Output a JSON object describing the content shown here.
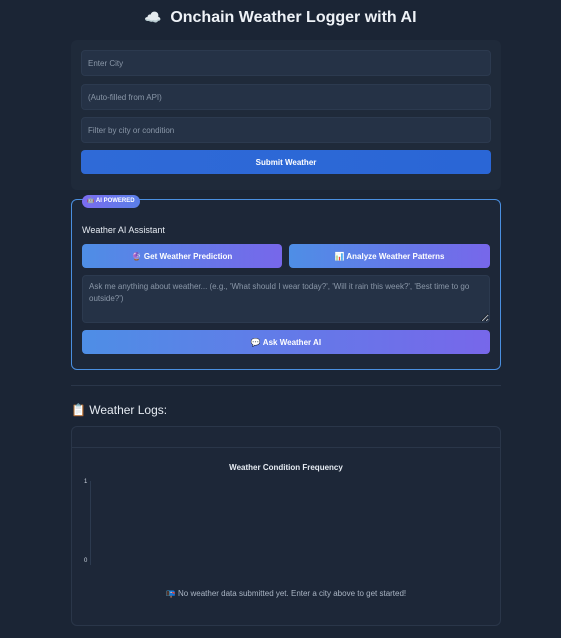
{
  "header": {
    "icon": "☁️",
    "title": "Onchain Weather Logger with AI"
  },
  "form": {
    "city_placeholder": "Enter City",
    "autofill_placeholder": "(Auto-filled from API)",
    "filter_placeholder": "Filter by city or condition",
    "submit_label": "Submit Weather",
    "accent_color": "#2f6ad7"
  },
  "ai": {
    "badge": "🤖 AI POWERED",
    "title": "Weather AI Assistant",
    "predict_label": "🔮 Get Weather Prediction",
    "analyze_label": "📊 Analyze Weather Patterns",
    "prompt_placeholder": "Ask me anything about weather... (e.g., 'What should I wear today?', 'Will it rain this week?', 'Best time to go outside?')",
    "ask_label": "💬 Ask Weather AI",
    "gradient_start": "#4e8ee6",
    "gradient_end": "#7767ea"
  },
  "logs": {
    "heading": "📋 Weather Logs:",
    "empty_message": "📭 No weather data submitted yet. Enter a city above to get started!"
  },
  "chart_data": {
    "type": "bar",
    "title": "Weather Condition Frequency",
    "categories": [],
    "values": [],
    "yticks": [
      "1",
      "0"
    ],
    "ylim": [
      0,
      1
    ]
  }
}
